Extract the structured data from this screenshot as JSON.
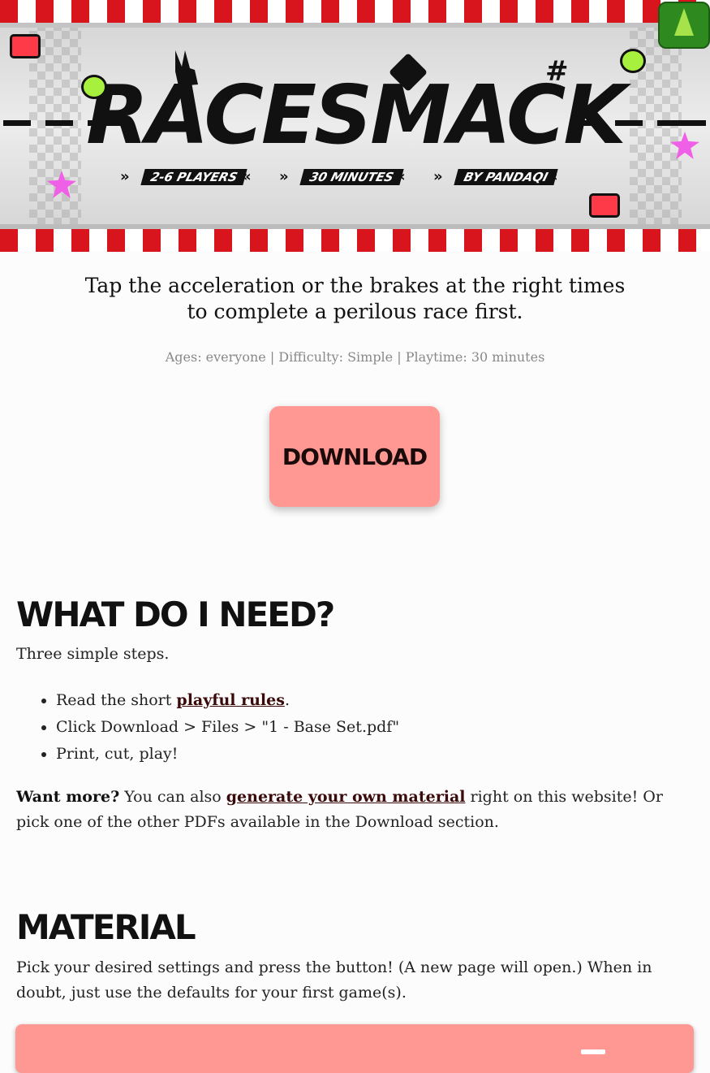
{
  "header": {
    "title": "RACESMACK",
    "players": "2-6 PLAYERS",
    "duration": "30 MINUTES",
    "author": "BY PANDAQI",
    "colors": {
      "stripe_red": "#d8141c",
      "token_red": "#ff3a48",
      "token_green": "#a8f03e",
      "token_pink": "#f060e6"
    }
  },
  "corner_button": {
    "icon": "traffic-cone-download-icon"
  },
  "tagline": "Tap the acceleration or the brakes at the right times to complete a perilous race first.",
  "tagline_line1": "Tap the acceleration or the brakes at the right times",
  "tagline_line2": "to complete a perilous race first.",
  "meta": "Ages: everyone | Difficulty: Simple | Playtime: 30 minutes",
  "download_button": {
    "label": "DOWNLOAD",
    "color": "#ff9893"
  },
  "need_section": {
    "heading": "WHAT DO I NEED?",
    "intro": "Three simple steps.",
    "step1_prefix": "Read the short ",
    "step1_link": "playful rules",
    "step1_suffix": ".",
    "step2": "Click Download > Files > \"1 - Base Set.pdf\"",
    "step3": "Print, cut, play!",
    "more_bold": "Want more?",
    "more_pre": " You can also ",
    "more_link": "generate your own material",
    "more_post": " right on this website! Or pick one of the other PDFs available in the Download section."
  },
  "material_section": {
    "heading": "MATERIAL",
    "intro": "Pick your desired settings and press the button! (A new page will open.) When in doubt, just use the defaults for your first game(s)."
  }
}
